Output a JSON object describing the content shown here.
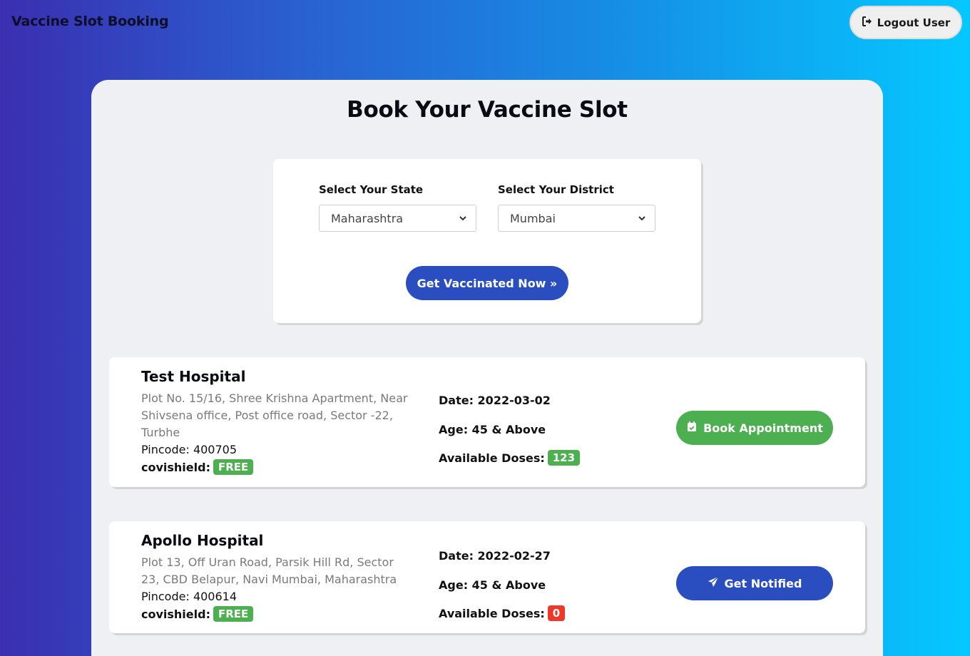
{
  "header": {
    "brand": "Vaccine Slot Booking",
    "logout_label": "Logout User"
  },
  "page": {
    "title": "Book Your Vaccine Slot"
  },
  "filters": {
    "state_label": "Select Your State",
    "state_value": "Maharashtra",
    "district_label": "Select Your District",
    "district_value": "Mumbai",
    "submit_label": "Get Vaccinated Now »"
  },
  "hospitals": [
    {
      "name": "Test Hospital",
      "address": "Plot No. 15/16, Shree Krishna Apartment, Near Shivsena office, Post office road, Sector -22, Turbhe",
      "pincode": "Pincode: 400705",
      "vaccine_label": "covishield:",
      "fee": "FREE",
      "date": "Date: 2022-03-02",
      "age": "Age: 45 & Above",
      "doses_label": "Available Doses:",
      "doses": "123",
      "action_label": "Book Appointment"
    },
    {
      "name": "Apollo Hospital",
      "address": "Plot 13, Off Uran Road, Parsik Hill Rd, Sector 23, CBD Belapur, Navi Mumbai, Maharashtra",
      "pincode": "Pincode: 400614",
      "vaccine_label": "covishield:",
      "fee": "FREE",
      "date": "Date: 2022-02-27",
      "age": "Age: 45 & Above",
      "doses_label": "Available Doses:",
      "doses": "0",
      "action_label": "Get Notified"
    }
  ],
  "colors": {
    "primary": "#2a4ec0",
    "success": "#4caf50",
    "danger": "#f0382a",
    "card_bg": "#eff0f4"
  },
  "icons": {
    "logout": "sign-out-icon",
    "book": "calendar-check-icon",
    "notify": "paper-plane-icon",
    "dropdown": "chevron-down-icon"
  }
}
